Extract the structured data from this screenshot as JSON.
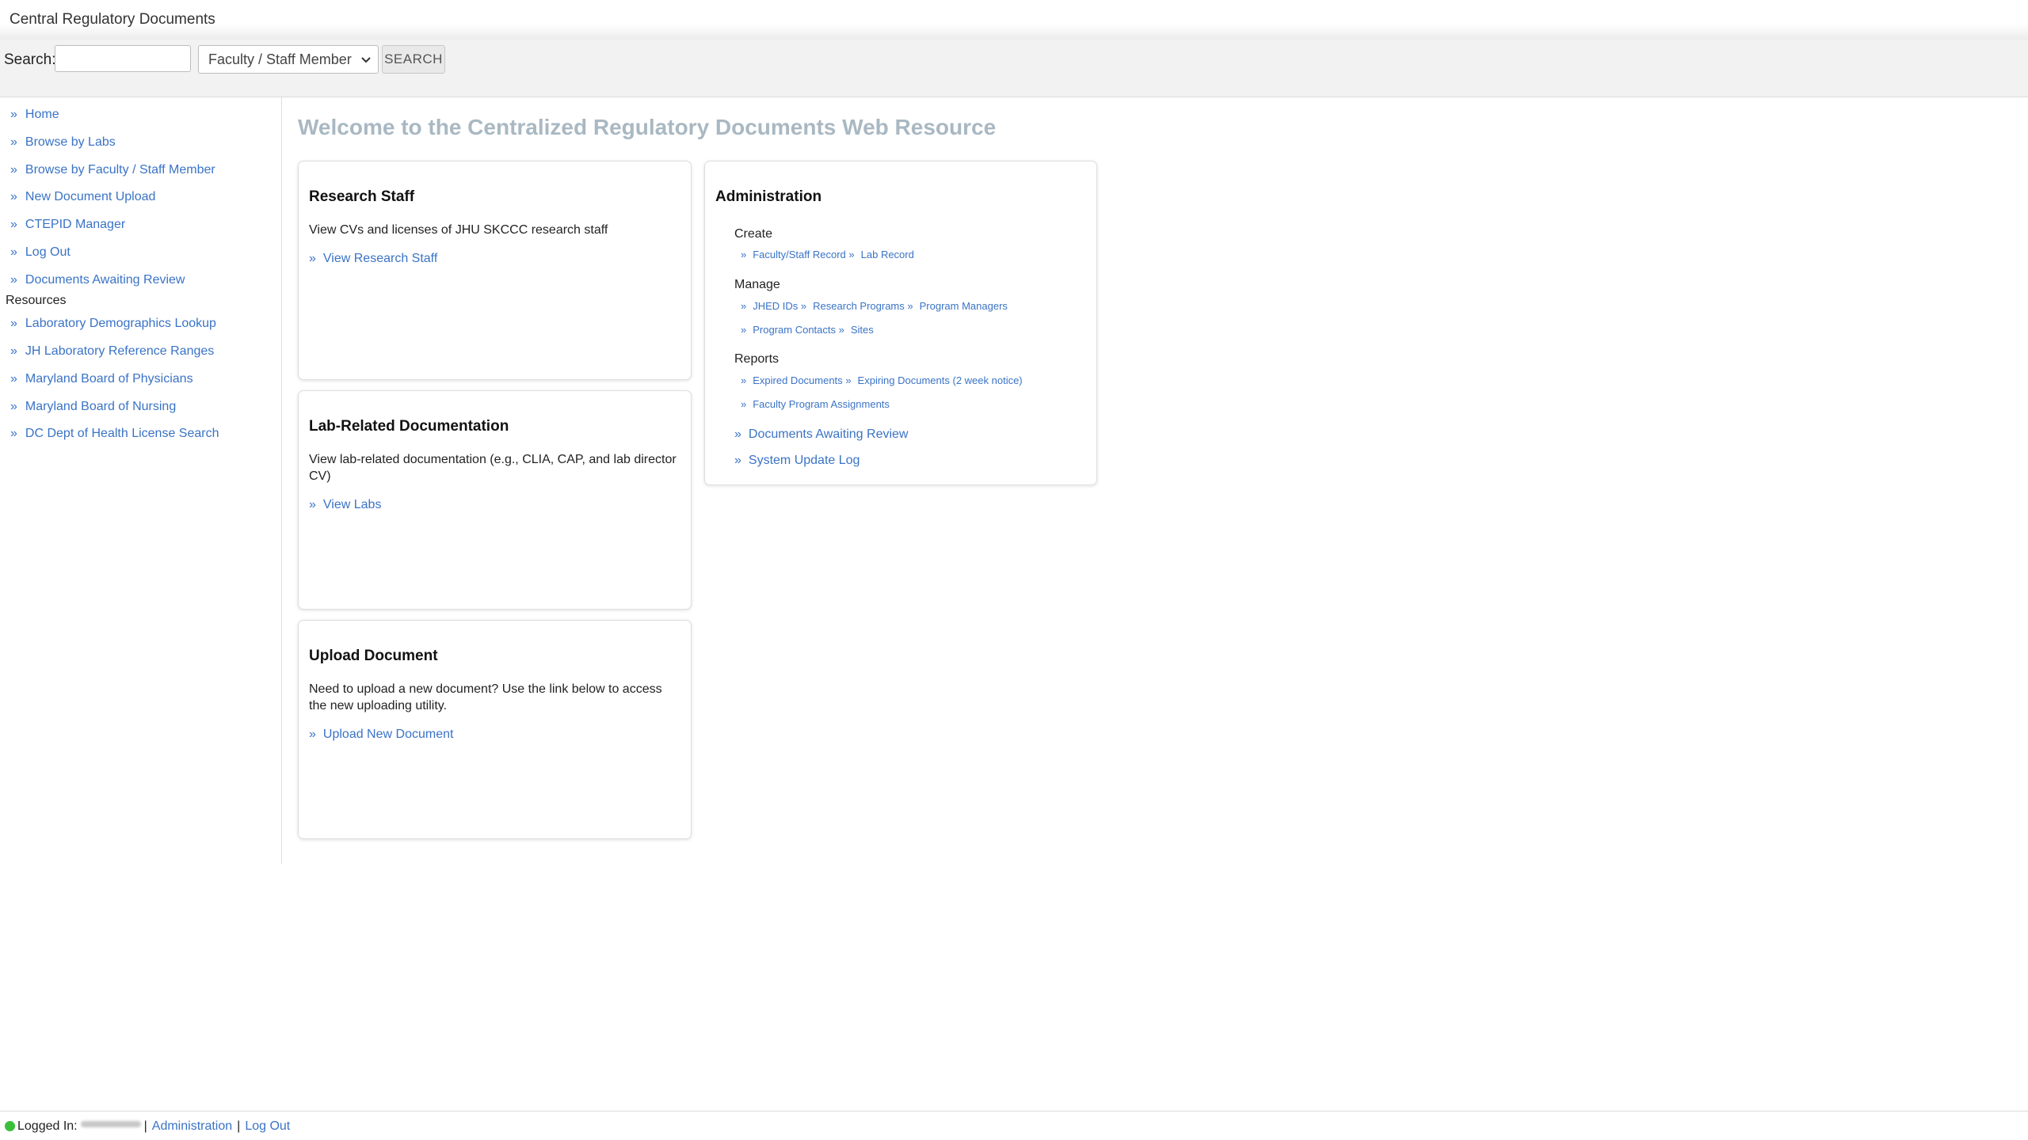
{
  "header": {
    "title": "Central Regulatory Documents"
  },
  "search": {
    "label": "Search:",
    "input_value": "",
    "select_value": "Faculty / Staff Member",
    "button_label": "SEARCH"
  },
  "sidebar": {
    "items": [
      {
        "label": "Home"
      },
      {
        "label": "Browse by Labs"
      },
      {
        "label": "Browse by Faculty / Staff Member"
      },
      {
        "label": "New Document Upload"
      },
      {
        "label": "CTEPID Manager"
      },
      {
        "label": "Log Out"
      },
      {
        "label": "Documents Awaiting Review"
      }
    ],
    "resources_heading": "Resources",
    "resources": [
      {
        "label": "Laboratory Demographics Lookup"
      },
      {
        "label": "JH Laboratory Reference Ranges"
      },
      {
        "label": "Maryland Board of Physicians"
      },
      {
        "label": "Maryland Board of Nursing"
      },
      {
        "label": "DC Dept of Health License Search"
      }
    ]
  },
  "main": {
    "welcome": "Welcome to the Centralized Regulatory Documents Web Resource",
    "panels": {
      "research_staff": {
        "title": "Research Staff",
        "desc": "View CVs and licenses of JHU SKCCC research staff",
        "link": "View Research Staff"
      },
      "lab_docs": {
        "title": "Lab-Related Documentation",
        "desc": "View lab-related documentation (e.g., CLIA, CAP, and lab director CV)",
        "link": "View Labs"
      },
      "upload": {
        "title": "Upload Document",
        "desc": "Need to upload a new document? Use the link below to access the new uploading utility.",
        "link": "Upload New Document"
      }
    },
    "admin": {
      "title": "Administration",
      "create_label": "Create",
      "create_links": [
        "Faculty/Staff Record",
        "Lab Record"
      ],
      "manage_label": "Manage",
      "manage_links_row1": [
        "JHED IDs",
        "Research Programs",
        "Program Managers"
      ],
      "manage_links_row2": [
        "Program Contacts",
        "Sites"
      ],
      "reports_label": "Reports",
      "reports_links_row1": [
        "Expired Documents",
        "Expiring Documents (2 week notice)"
      ],
      "reports_links_row2": [
        "Faculty Program Assignments"
      ],
      "links": [
        "Documents Awaiting Review",
        "System Update Log"
      ]
    }
  },
  "footer": {
    "logged_in_label": "Logged In:",
    "admin_link": "Administration",
    "logout_link": "Log Out",
    "separator": "|"
  },
  "glyphs": {
    "raquo": "»",
    "chevron": "⌄"
  },
  "colors": {
    "link": "#3a73c6",
    "welcome": "#a9b8c2",
    "status_online": "#3bbf3b"
  }
}
